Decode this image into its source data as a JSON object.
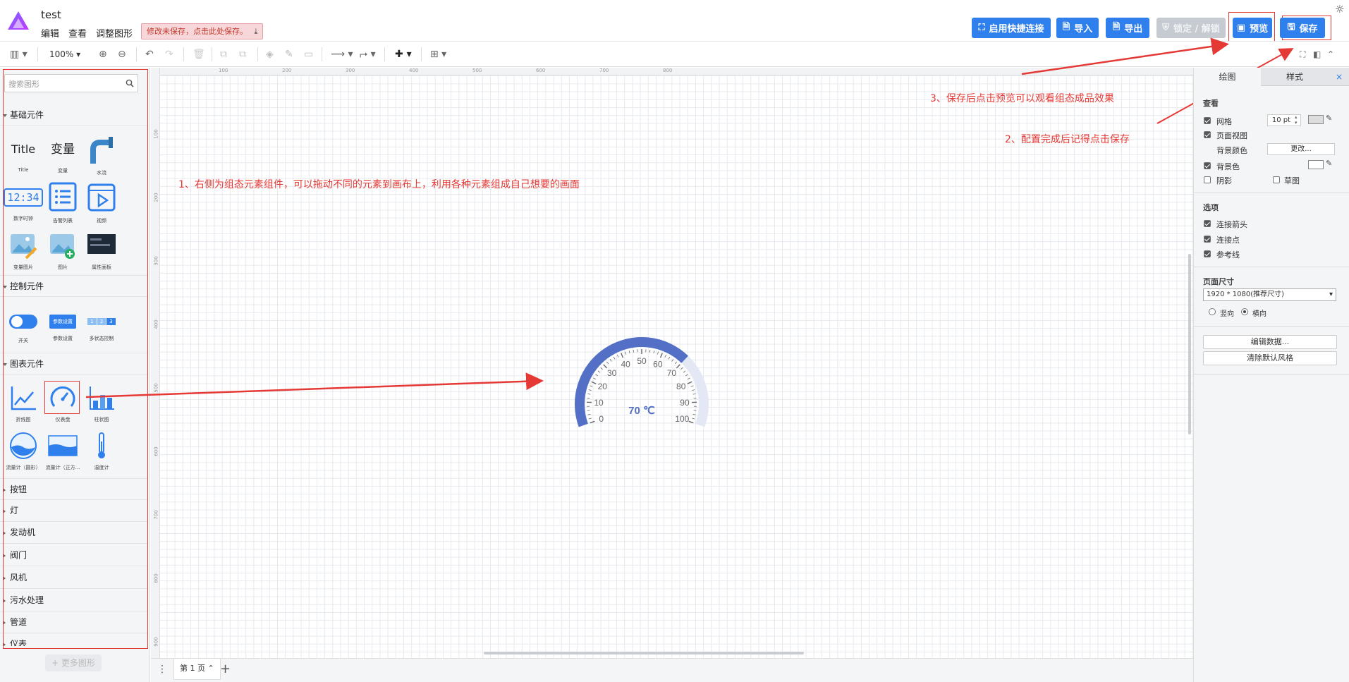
{
  "app": {
    "title": "test",
    "menu": [
      "编辑",
      "查看",
      "调整图形"
    ],
    "unsaved_notice": "修改未保存，点击此处保存。"
  },
  "header_buttons": {
    "quick_connect": "启用快捷连接",
    "import": "导入",
    "export": "导出",
    "lock": "锁定 / 解锁",
    "preview": "预览",
    "save": "保存"
  },
  "toolbar": {
    "zoom": "100%"
  },
  "left_panel": {
    "search_placeholder": "搜索图形",
    "sections": {
      "basic": "基础元件",
      "control": "控制元件",
      "chart": "图表元件"
    },
    "basic_items": [
      "Title",
      "变量",
      "水流",
      "数字时钟",
      "告警列表",
      "视频",
      "变量图片",
      "图片",
      "属性面板"
    ],
    "basic_glyphs": {
      "title": "Title",
      "variable": "变量",
      "clock": "12:34"
    },
    "control_items": [
      "开关",
      "参数设置",
      "多状态控制"
    ],
    "control_glyphs": {
      "param_button": "参数设置",
      "multi": [
        "1",
        "2",
        "3"
      ]
    },
    "chart_items": [
      "折线图",
      "仪表盘",
      "柱状图",
      "流量计（圆形）",
      "流量计（正方...",
      "温度计"
    ],
    "collapsed_sections": [
      "按钮",
      "灯",
      "发动机",
      "阀门",
      "风机",
      "污水处理",
      "管道",
      "仪表"
    ],
    "more_shapes": "+ 更多图形"
  },
  "canvas": {
    "annotations": {
      "a1": "1、右侧为组态元素组件，可以拖动不同的元素到画布上，利用各种元素组成自己想要的画面",
      "a2": "2、配置完成后记得点击保存",
      "a3": "3、保存后点击预览可以观看组态成品效果"
    },
    "ruler_top": [
      "100",
      "200",
      "300",
      "400",
      "500",
      "600",
      "700",
      "800"
    ],
    "ruler_left": [
      "100",
      "200",
      "300",
      "400",
      "500",
      "600",
      "700",
      "800",
      "900"
    ],
    "gauge": {
      "value": 70,
      "min": 0,
      "max": 100,
      "readout": "70 ℃",
      "ticks": [
        "0",
        "10",
        "20",
        "30",
        "40",
        "50",
        "60",
        "70",
        "80",
        "90",
        "100"
      ],
      "fill_color": "#5470c6",
      "track_color": "#e3e8f4"
    }
  },
  "bottom": {
    "page_tab": "第 1 页"
  },
  "right_panel": {
    "tabs": [
      "绘图",
      "样式"
    ],
    "view_heading": "查看",
    "grid_label": "网格",
    "grid_size": "10 pt",
    "page_view_label": "页面视图",
    "bg_color_label": "背景颜色",
    "change_button": "更改...",
    "background_label": "背景色",
    "shadow_label": "阴影",
    "sketch_label": "草图",
    "options_heading": "选项",
    "connect_arrows": "连接箭头",
    "connect_points": "连接点",
    "guides": "参考线",
    "page_size_heading": "页面尺寸",
    "page_size_value": "1920 * 1080(推荐尺寸)",
    "portrait": "竖向",
    "landscape": "横向",
    "edit_data": "编辑数据...",
    "clear_style": "清除默认风格"
  },
  "colors": {
    "accent": "#2f80ed",
    "annotation": "#e53935"
  }
}
